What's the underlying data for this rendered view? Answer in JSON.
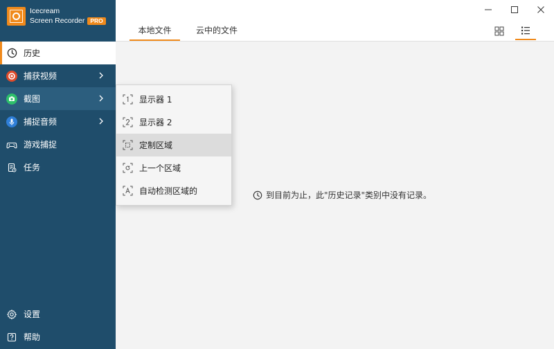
{
  "app": {
    "name_line1": "Icecream",
    "name_line2": "Screen Recorder",
    "badge": "PRO",
    "accent_color": "#f08a1c",
    "sidebar_color": "#1f4d6b"
  },
  "sidebar": {
    "items": [
      {
        "label": "历史",
        "icon": "clock-icon"
      },
      {
        "label": "捕获视频",
        "icon": "record-icon"
      },
      {
        "label": "截图",
        "icon": "camera-icon"
      },
      {
        "label": "捕捉音频",
        "icon": "microphone-icon"
      },
      {
        "label": "游戏捕捉",
        "icon": "gamepad-icon"
      },
      {
        "label": "任务",
        "icon": "task-icon"
      }
    ],
    "bottom": [
      {
        "label": "设置",
        "icon": "gear-icon"
      },
      {
        "label": "帮助",
        "icon": "help-icon"
      }
    ]
  },
  "tabs": [
    {
      "label": "本地文件"
    },
    {
      "label": "云中的文件"
    }
  ],
  "screenshot_menu": {
    "items": [
      {
        "label": "显示器 1",
        "icon": "monitor-1-icon"
      },
      {
        "label": "显示器 2",
        "icon": "monitor-2-icon"
      },
      {
        "label": "定制区域",
        "icon": "custom-area-icon"
      },
      {
        "label": "上一个区域",
        "icon": "previous-area-icon"
      },
      {
        "label": "自动检测区域的",
        "icon": "auto-detect-icon"
      }
    ]
  },
  "main": {
    "empty_message": "到目前为止，此\"历史记录\"类别中没有记录。"
  }
}
